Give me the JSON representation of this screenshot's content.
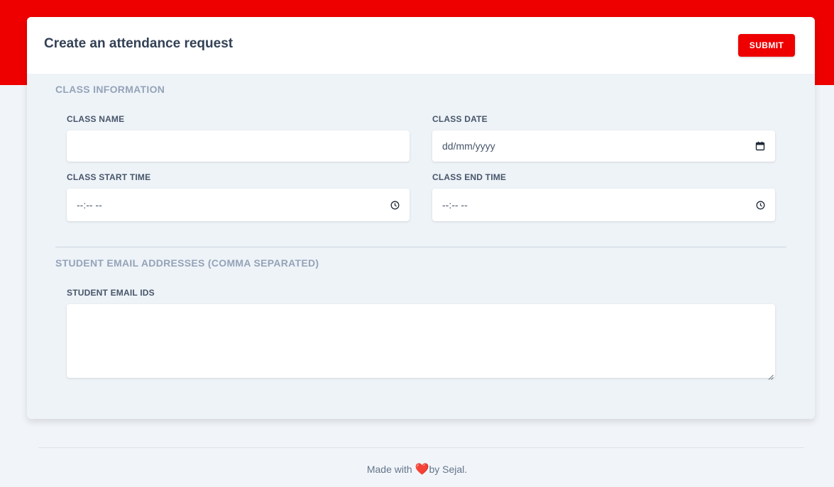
{
  "header": {
    "title": "Create an attendance request",
    "submit_label": "SUBMIT"
  },
  "class_information": {
    "heading": "CLASS INFORMATION",
    "class_name": {
      "label": "CLASS NAME",
      "value": "",
      "placeholder": ""
    },
    "class_date": {
      "label": "CLASS DATE",
      "value": "",
      "placeholder": "dd/mm/yyyy",
      "icon": "calendar-icon"
    },
    "class_start_time": {
      "label": "CLASS START TIME",
      "value": "",
      "placeholder": "--:-- --",
      "icon": "clock-icon"
    },
    "class_end_time": {
      "label": "CLASS END TIME",
      "value": "",
      "placeholder": "--:-- --",
      "icon": "clock-icon"
    }
  },
  "student_emails": {
    "heading": "STUDENT EMAIL ADDRESSES (COMMA SEPARATED)",
    "label": "STUDENT EMAIL IDS",
    "value": ""
  },
  "footer": {
    "text_before": "Made with ",
    "heart": "❤️",
    "text_after": "by Sejal."
  },
  "colors": {
    "accent": "#ee0000",
    "card_body": "#eef3f8",
    "heading_muted": "#94a3b8"
  }
}
